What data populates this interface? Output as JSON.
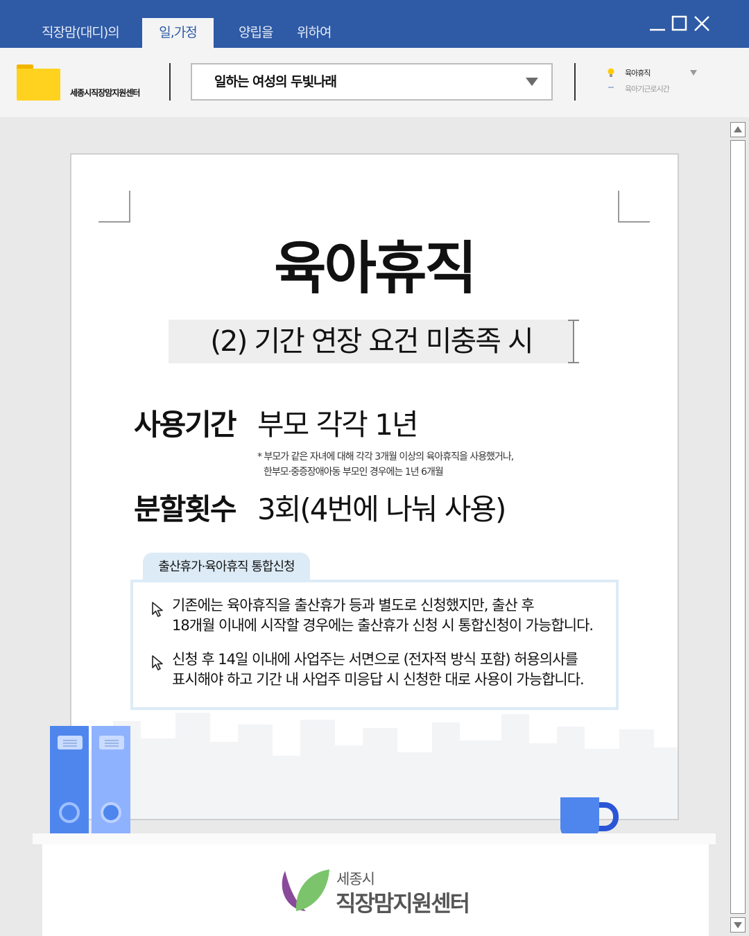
{
  "window": {
    "tabs": [
      {
        "label": "직장맘(대디)의"
      },
      {
        "label": "일,가정"
      },
      {
        "label": "양립을"
      },
      {
        "label": "위하여"
      }
    ],
    "active_tab": 1,
    "controls": {
      "minimize": "minimize-icon",
      "maximize": "maximize-icon",
      "close": "close-icon"
    }
  },
  "toolbar": {
    "folder_label": "세종시직장맘지원센터",
    "dropdown_value": "일하는 여성의 두빛나래",
    "topics": [
      {
        "label": "육아휴직",
        "icon": "lightbulb-icon"
      },
      {
        "label": "육아기근로시간",
        "icon": "dash-icon"
      }
    ]
  },
  "document": {
    "title": "육아휴직",
    "subtitle": "(2) 기간 연장 요건 미충족 시",
    "usage_label": "사용기간",
    "usage_value": "부모 각각 1년",
    "note_line1": "* 부모가 같은 자녀에 대해 각각 3개월 이상의 육아휴직을 사용했거나,",
    "note_line2": "한부모·중증장애아동 부모인 경우에는 1년 6개월",
    "split_label": "분할횟수",
    "split_value": "3회(4번에 나눠 사용)",
    "box_tab": "출산휴가·육아휴직 통합신청",
    "bullets": [
      {
        "line1": "기존에는 육아휴직을 출산휴가 등과 별도로 신청했지만, 출산 후",
        "line2": "18개월 이내에 시작할 경우에는 출산휴가 신청 시 통합신청이 가능합니다."
      },
      {
        "line1": "신청 후 14일 이내에 사업주는 서면으로 (전자적 방식 포함) 허용의사를",
        "line2": "표시해야 하고 기간 내 사업주 미응답 시 신청한 대로 사용이 가능합니다."
      }
    ]
  },
  "footer": {
    "logo_small": "세종시",
    "logo_big": "직장맘지원센터"
  },
  "colors": {
    "titlebar": "#2e5aa6",
    "folder": "#ffd21f",
    "binder_dark": "#4f86ee",
    "binder_light": "#8fb2ff",
    "box_border": "#dcebf6"
  }
}
